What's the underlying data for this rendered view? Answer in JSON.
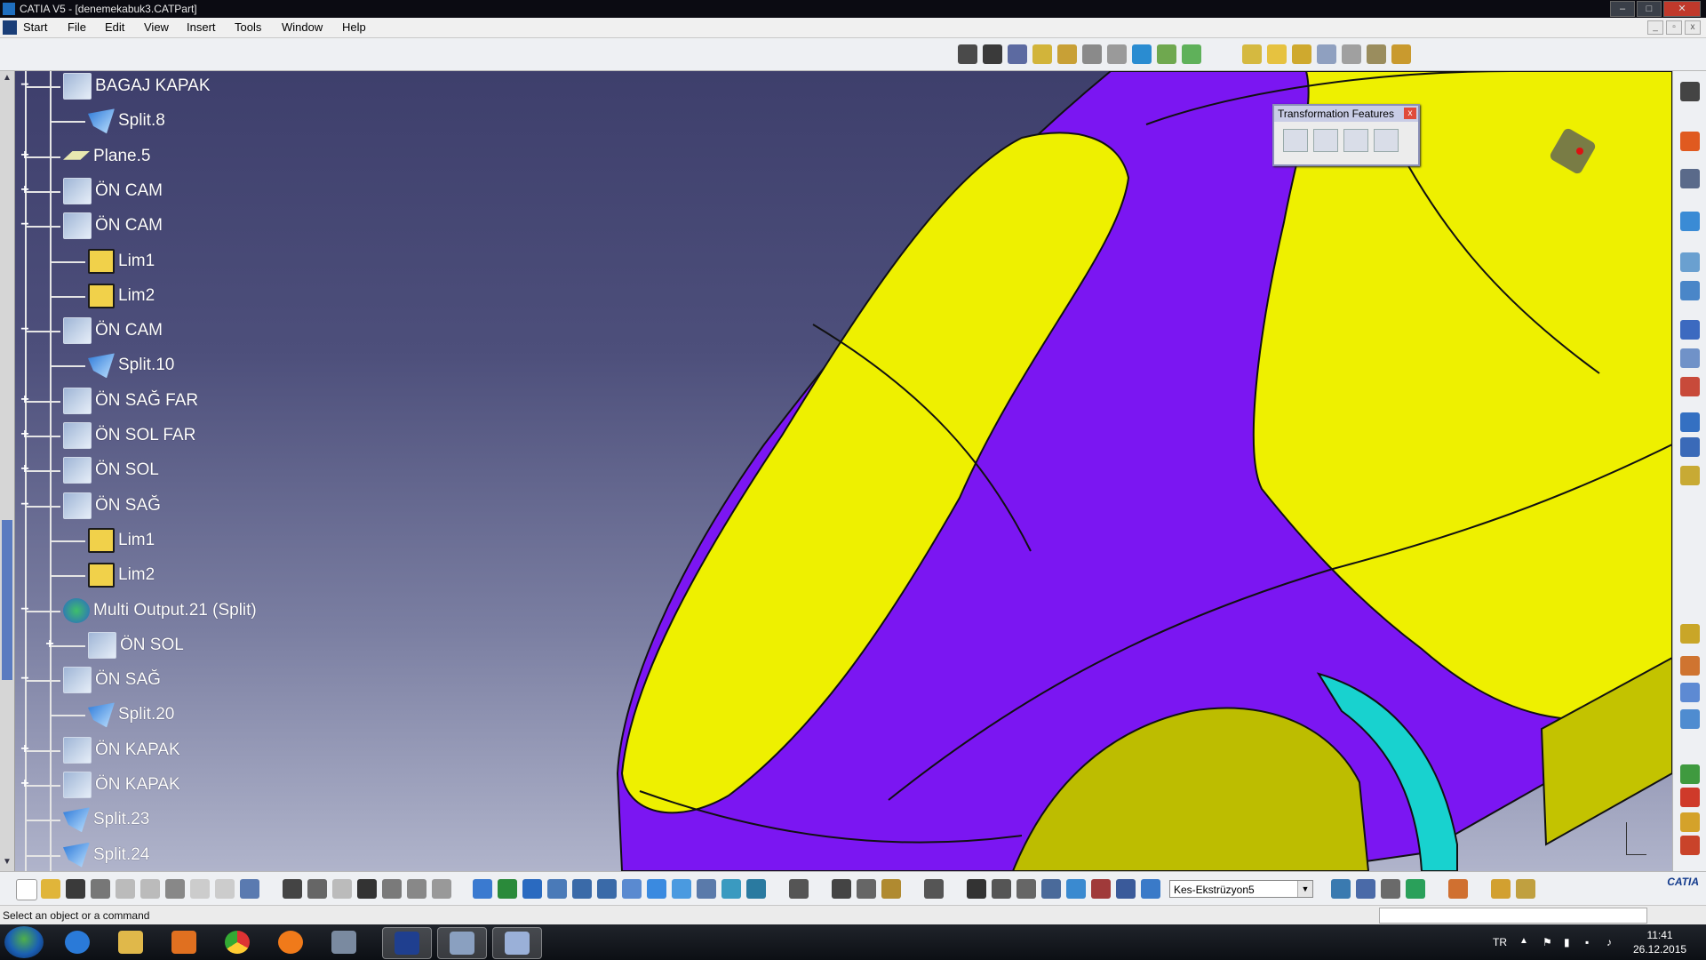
{
  "window": {
    "title": "CATIA V5 - [denemekabuk3.CATPart]",
    "min": "–",
    "max": "□",
    "close": "✕"
  },
  "menu": [
    "Start",
    "File",
    "Edit",
    "View",
    "Insert",
    "Tools",
    "Window",
    "Help"
  ],
  "tree": [
    {
      "label": "BAGAJ KAPAK",
      "level": 0,
      "icon": "geo",
      "expander": "−"
    },
    {
      "label": "Split.8",
      "level": 1,
      "icon": "split",
      "expander": ""
    },
    {
      "label": "Plane.5",
      "level": 0,
      "icon": "plane",
      "expander": "+"
    },
    {
      "label": "ÖN CAM",
      "level": 0,
      "icon": "geo",
      "expander": "+"
    },
    {
      "label": "ÖN CAM",
      "level": 0,
      "icon": "geo",
      "expander": "−"
    },
    {
      "label": "Lim1",
      "level": 1,
      "icon": "box",
      "expander": ""
    },
    {
      "label": "Lim2",
      "level": 1,
      "icon": "box",
      "expander": ""
    },
    {
      "label": "ÖN CAM",
      "level": 0,
      "icon": "geo",
      "expander": "−"
    },
    {
      "label": "Split.10",
      "level": 1,
      "icon": "split",
      "expander": ""
    },
    {
      "label": "ÖN SAĞ FAR",
      "level": 0,
      "icon": "geo",
      "expander": "+"
    },
    {
      "label": "ÖN SOL FAR",
      "level": 0,
      "icon": "geo",
      "expander": "+"
    },
    {
      "label": "ÖN SOL",
      "level": 0,
      "icon": "geo",
      "expander": "+"
    },
    {
      "label": "ÖN SAĞ",
      "level": 0,
      "icon": "geo",
      "expander": "−"
    },
    {
      "label": "Lim1",
      "level": 1,
      "icon": "box",
      "expander": ""
    },
    {
      "label": "Lim2",
      "level": 1,
      "icon": "box",
      "expander": ""
    },
    {
      "label": "Multi Output.21 (Split)",
      "level": 0,
      "icon": "multi",
      "expander": "−"
    },
    {
      "label": "ÖN SOL",
      "level": 1,
      "icon": "geo",
      "expander": "+"
    },
    {
      "label": "ÖN SAĞ",
      "level": 0,
      "icon": "geo",
      "expander": "−"
    },
    {
      "label": "Split.20",
      "level": 1,
      "icon": "split",
      "expander": ""
    },
    {
      "label": "ÖN KAPAK",
      "level": 0,
      "icon": "geo",
      "expander": "+"
    },
    {
      "label": "ÖN KAPAK",
      "level": 0,
      "icon": "geo",
      "expander": "+"
    },
    {
      "label": "Split.23",
      "level": 0,
      "icon": "split",
      "expander": ""
    },
    {
      "label": "Split.24",
      "level": 0,
      "icon": "split",
      "expander": ""
    }
  ],
  "transform_dialog": {
    "title": "Transformation Features",
    "icons": [
      "translate-icon",
      "mirror-icon",
      "pattern-icon",
      "scale-icon"
    ]
  },
  "toolbar_combo": {
    "value": "Kes-Ekstrüzyon5"
  },
  "brand": "CATIA",
  "status": {
    "message": "Select an object or a command"
  },
  "taskbar": {
    "apps": [
      "internet-explorer-icon",
      "file-explorer-icon",
      "media-player-icon",
      "chrome-icon",
      "firefox-icon",
      "paint-app-icon",
      "catia-icon",
      "paint-brush-icon",
      "window-app-icon"
    ],
    "lang": "TR",
    "time": "11:41",
    "date": "26.12.2015"
  },
  "colors": {
    "surface_purple": "#7b16f2",
    "surface_yellow": "#eef000",
    "surface_cyan": "#18d2cf",
    "bg_top": "#3e3f6c",
    "bg_bottom": "#b0b4cb"
  }
}
